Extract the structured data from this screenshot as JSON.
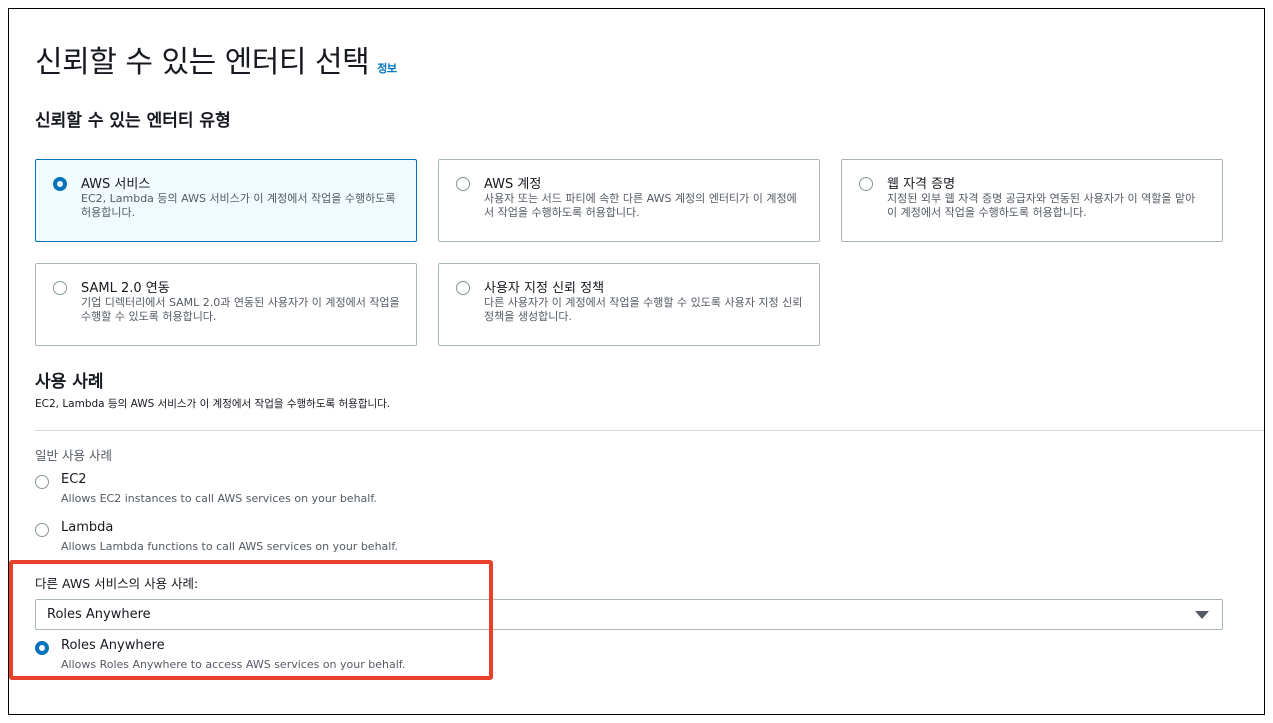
{
  "header": {
    "title": "신뢰할 수 있는 엔터티 선택",
    "info_link": "정보"
  },
  "trusted_entity": {
    "section_title": "신뢰할 수 있는 엔터티 유형",
    "options": [
      {
        "title": "AWS 서비스",
        "desc": "EC2, Lambda 등의 AWS 서비스가 이 계정에서 작업을 수행하도록 허용합니다.",
        "selected": true
      },
      {
        "title": "AWS 계정",
        "desc": "사용자 또는 서드 파티에 속한 다른 AWS 계정의 엔터티가 이 계정에서 작업을 수행하도록 허용합니다.",
        "selected": false
      },
      {
        "title": "웹 자격 증명",
        "desc": "지정된 외부 웹 자격 증명 공급자와 연동된 사용자가 이 역할을 맡아 이 계정에서 작업을 수행하도록 허용합니다.",
        "selected": false
      },
      {
        "title": "SAML 2.0 연동",
        "desc": "기업 디렉터리에서 SAML 2.0과 연동된 사용자가 이 계정에서 작업을 수행할 수 있도록 허용합니다.",
        "selected": false
      },
      {
        "title": "사용자 지정 신뢰 정책",
        "desc": "다른 사용자가 이 계정에서 작업을 수행할 수 있도록 사용자 지정 신뢰 정책을 생성합니다.",
        "selected": false
      }
    ]
  },
  "use_case": {
    "title": "사용 사례",
    "desc": "EC2, Lambda 등의 AWS 서비스가 이 계정에서 작업을 수행하도록 허용합니다.",
    "common_label": "일반 사용 사례",
    "common_options": [
      {
        "title": "EC2",
        "desc": "Allows EC2 instances to call AWS services on your behalf.",
        "selected": false
      },
      {
        "title": "Lambda",
        "desc": "Allows Lambda functions to call AWS services on your behalf.",
        "selected": false
      }
    ],
    "other_label": "다른 AWS 서비스의 사용 사례:",
    "other_select_value": "Roles Anywhere",
    "other_options": [
      {
        "title": "Roles Anywhere",
        "desc": "Allows Roles Anywhere to access AWS services on your behalf.",
        "selected": true
      }
    ]
  },
  "colors": {
    "accent": "#0073bb",
    "highlight": "#e8402a"
  }
}
